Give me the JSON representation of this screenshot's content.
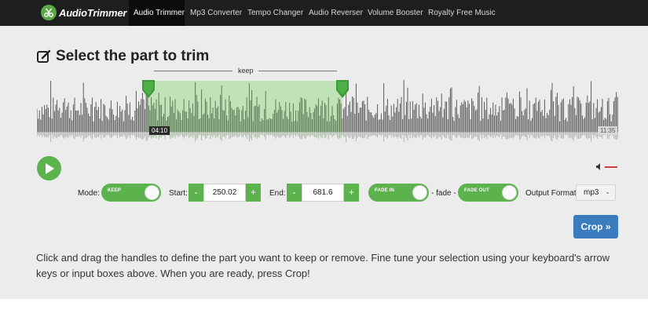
{
  "nav": {
    "logo_text": "AudioTrimmer",
    "items": [
      {
        "label": "Audio Trimmer",
        "active": true
      },
      {
        "label": "Mp3 Converter",
        "active": false
      },
      {
        "label": "Tempo Changer",
        "active": false
      },
      {
        "label": "Audio Reverser",
        "active": false
      },
      {
        "label": "Volume Booster",
        "active": false
      },
      {
        "label": "Royalty Free Music",
        "active": false
      }
    ]
  },
  "editor": {
    "title": "Select the part to trim",
    "selection_label": "keep",
    "selection_time": "04:10",
    "total_time": "11:35"
  },
  "controls": {
    "mode_label": "Mode:",
    "mode_value": "KEEP",
    "start_label": "Start:",
    "start_value": "250.02",
    "end_label": "End:",
    "end_value": "681.6",
    "minus": "-",
    "plus": "+",
    "fade_in": "FADE IN",
    "fade_sep": "- fade -",
    "fade_out": "FADE OUT",
    "format_label": "Output Format",
    "format_value": "mp3",
    "crop_label": "Crop »"
  },
  "help_text": "Click and drag the handles to define the part you want to keep or remove. Fine tune your selection using your keyboard's arrow keys or input boxes above. When you are ready, press Crop!",
  "colors": {
    "accent_green": "#5cb34e",
    "selection_fill": "#bfe2b6",
    "crop_blue": "#3a7cbd",
    "navbar": "#1e1e1e",
    "mute_red": "#d23a3a"
  },
  "icons": {
    "edit": "edit-square-icon",
    "play": "play-icon",
    "volume": "volume-icon",
    "handle": "trim-handle-icon"
  }
}
